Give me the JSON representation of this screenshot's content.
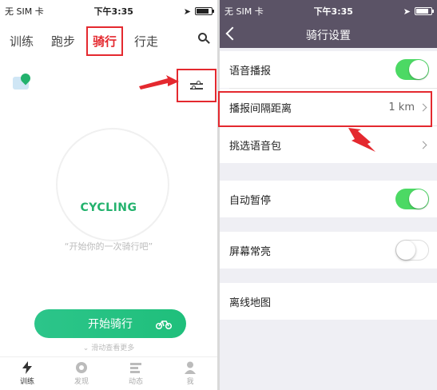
{
  "left": {
    "status": {
      "carrier": "无 SIM 卡",
      "time": "下午3:35"
    },
    "tabs": [
      "训练",
      "跑步",
      "骑行",
      "行走"
    ],
    "active_tab": "骑行",
    "center_label": "CYCLING",
    "quote": "“开始你的一次骑行吧”",
    "start_button": "开始骑行",
    "scroll_hint": "滑动查看更多",
    "bottom_nav": [
      "训练",
      "发现",
      "动态",
      "我"
    ]
  },
  "right": {
    "status": {
      "carrier": "无 SIM 卡",
      "time": "下午3:35"
    },
    "title": "骑行设置",
    "rows": {
      "voice": "语音播报",
      "interval": "播报间隔距离",
      "interval_value": "1 km",
      "voice_pack": "挑选语音包",
      "auto_pause": "自动暂停",
      "screen_on": "屏幕常亮",
      "offline_map": "离线地图"
    },
    "toggles": {
      "voice": true,
      "auto_pause": true,
      "screen_on": false
    }
  },
  "colors": {
    "accent": "#1fbf7b",
    "header": "#5b5366",
    "annotation": "#e4292f",
    "toggle_on": "#4cd964"
  }
}
